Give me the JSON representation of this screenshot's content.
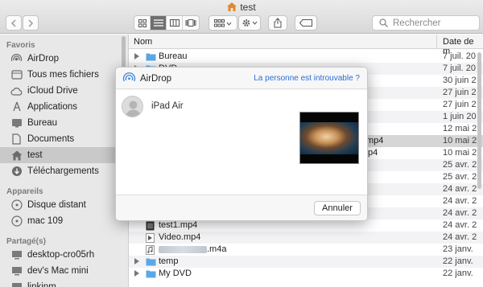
{
  "window": {
    "title": "test"
  },
  "toolbar": {
    "search_placeholder": "Rechercher"
  },
  "sidebar": {
    "sections": [
      {
        "label": "Favoris"
      },
      {
        "label": "Appareils"
      },
      {
        "label": "Partagé(s)"
      }
    ],
    "items": [
      {
        "label": "AirDrop",
        "icon": "airdrop-icon"
      },
      {
        "label": "Tous mes fichiers",
        "icon": "all-files-icon"
      },
      {
        "label": "iCloud Drive",
        "icon": "cloud-icon"
      },
      {
        "label": "Applications",
        "icon": "applications-icon"
      },
      {
        "label": "Bureau",
        "icon": "desktop-icon"
      },
      {
        "label": "Documents",
        "icon": "document-icon"
      },
      {
        "label": "test",
        "icon": "home-icon",
        "selected": true
      },
      {
        "label": "Téléchargements",
        "icon": "download-icon"
      },
      {
        "label": "Disque distant",
        "icon": "disk-icon"
      },
      {
        "label": "mac 109",
        "icon": "disk-icon"
      },
      {
        "label": "desktop-cro05rh",
        "icon": "display-icon"
      },
      {
        "label": "dev's Mac mini",
        "icon": "display-icon"
      },
      {
        "label": "linkipm",
        "icon": "display-icon"
      }
    ]
  },
  "list": {
    "columns": {
      "name": "Nom",
      "date": "Date de m"
    },
    "rows": [
      {
        "name": "Bureau",
        "date": "7 juil. 20",
        "kind": "folder"
      },
      {
        "name": "DVD",
        "date": "7 juil. 20",
        "kind": "folder"
      },
      {
        "name": "",
        "date": "30 juin 2",
        "kind": "hidden"
      },
      {
        "name": "",
        "date": "27 juin 2",
        "kind": "hidden"
      },
      {
        "name": "",
        "date": "27 juin 2",
        "kind": "hidden"
      },
      {
        "name": "",
        "date": "1 juin 20",
        "kind": "hidden"
      },
      {
        "name": "",
        "date": "12 mai 2",
        "kind": "hidden"
      },
      {
        "name": "mp4",
        "date": "10 mai 2",
        "kind": "hidden"
      },
      {
        "name": "p4",
        "date": "10 mai 2",
        "kind": "hidden"
      },
      {
        "name": "",
        "date": "25 avr. 2",
        "kind": "hidden"
      },
      {
        "name": "",
        "date": "25 avr. 2",
        "kind": "hidden"
      },
      {
        "name": "",
        "date": "24 avr. 2",
        "kind": "hidden"
      },
      {
        "name": "",
        "date": "24 avr. 2",
        "kind": "hidden"
      },
      {
        "name": "",
        "date": "24 avr. 2",
        "kind": "hidden"
      },
      {
        "name": "test1.mp4",
        "date": "24 avr. 2",
        "kind": "video"
      },
      {
        "name": "Video.mp4",
        "date": "24 avr. 2",
        "kind": "video"
      },
      {
        "name": ".m4a",
        "date": "23 janv.",
        "kind": "audio-blurred"
      },
      {
        "name": "temp",
        "date": "22 janv.",
        "kind": "folder"
      },
      {
        "name": "My DVD",
        "date": "22 janv.",
        "kind": "folder"
      }
    ]
  },
  "airdrop": {
    "title": "AirDrop",
    "help_link": "La personne est introuvable ?",
    "device_name": "iPad Air",
    "cancel_label": "Annuler"
  }
}
